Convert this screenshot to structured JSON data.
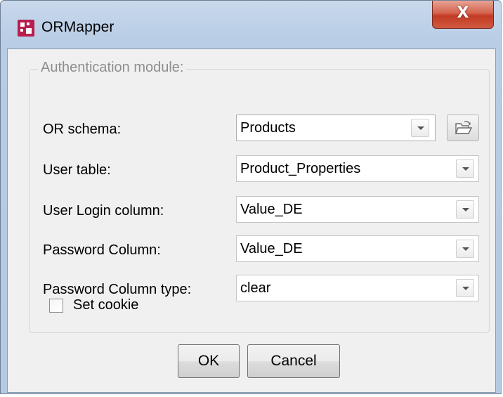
{
  "window": {
    "title": "ORMapper",
    "close_label": "X"
  },
  "group": {
    "legend": "Authentication module:"
  },
  "fields": {
    "or_schema": {
      "label": "OR schema:",
      "value": "Products"
    },
    "user_table": {
      "label": "User table:",
      "value": "Product_Properties"
    },
    "user_login_column": {
      "label": "User Login column:",
      "value": "Value_DE"
    },
    "password_column": {
      "label": "Password Column:",
      "value": "Value_DE"
    },
    "password_column_type": {
      "label": "Password Column type:",
      "value": "clear"
    }
  },
  "set_cookie": {
    "label": "Set cookie",
    "checked": false
  },
  "buttons": {
    "ok": "OK",
    "cancel": "Cancel"
  },
  "colors": {
    "app_icon": "#b81e4e",
    "close_button": "#c33a24",
    "dialog_background": "#f0f0f0",
    "frame": "#b7cce5"
  },
  "icons": {
    "app": "ormapper-app-icon",
    "close": "close-icon",
    "browse": "folder-open-icon",
    "dropdown": "chevron-down-icon"
  }
}
